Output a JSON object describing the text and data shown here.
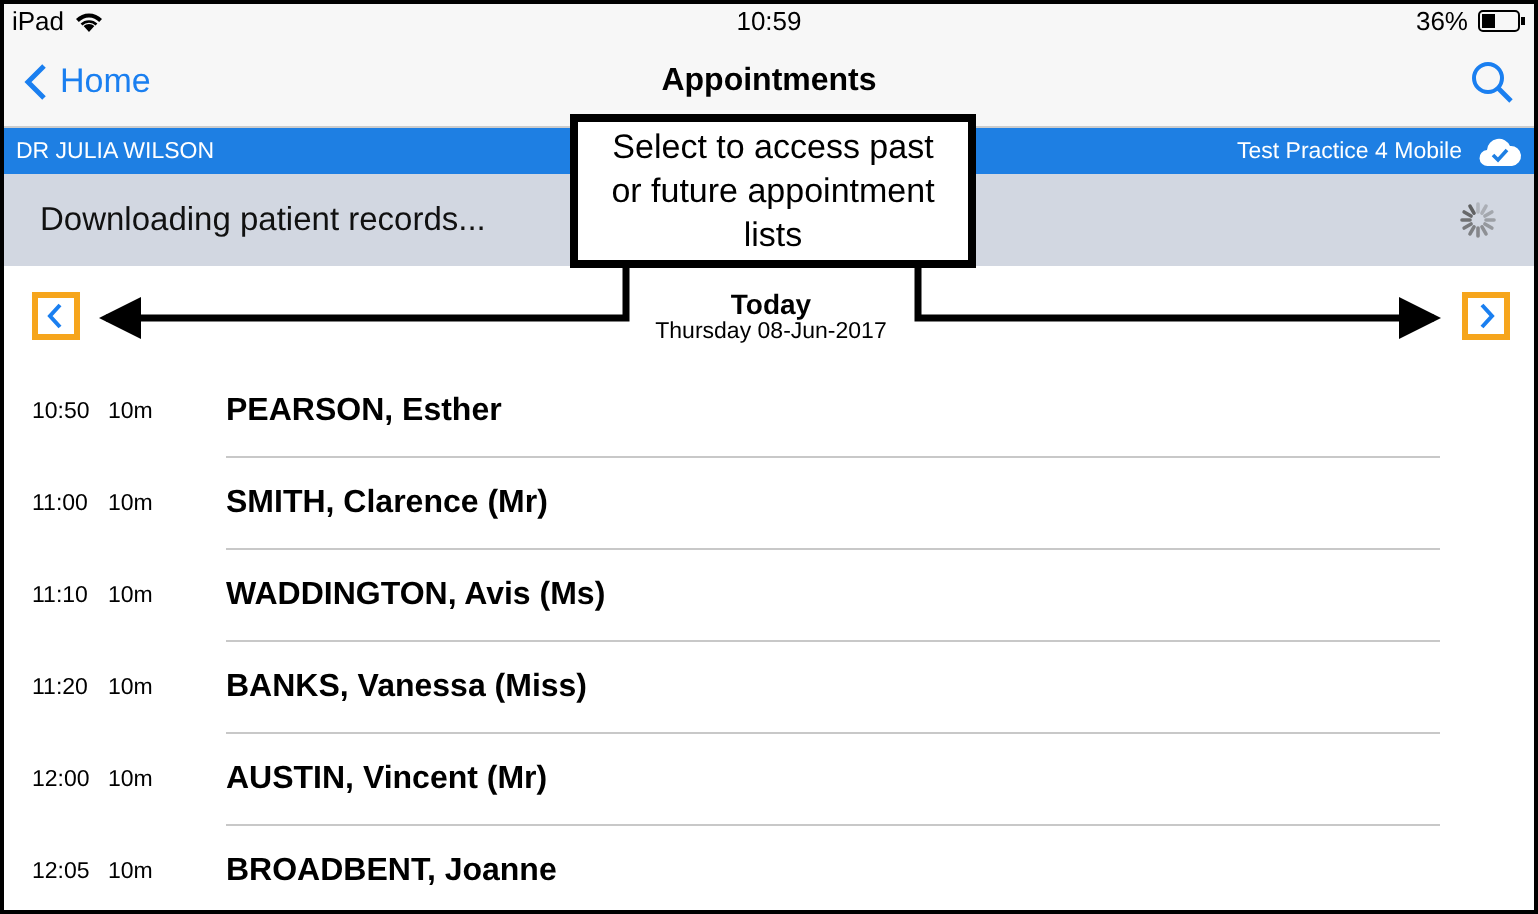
{
  "status_bar": {
    "device": "iPad",
    "time": "10:59",
    "battery": "36%"
  },
  "nav_bar": {
    "back": "Home",
    "title": "Appointments"
  },
  "info_bar": {
    "clinician": "DR JULIA WILSON",
    "practice": "Test Practice 4 Mobile"
  },
  "sync_banner": {
    "message": "Downloading patient records..."
  },
  "date_header": {
    "title": "Today",
    "date": "Thursday 08-Jun-2017"
  },
  "callout": {
    "text": "Select to access past or future appointment lists"
  },
  "appointments": [
    {
      "time": "10:50",
      "duration": "10m",
      "patient": "PEARSON, Esther"
    },
    {
      "time": "11:00",
      "duration": "10m",
      "patient": "SMITH, Clarence (Mr)"
    },
    {
      "time": "11:10",
      "duration": "10m",
      "patient": "WADDINGTON, Avis (Ms)"
    },
    {
      "time": "11:20",
      "duration": "10m",
      "patient": "BANKS, Vanessa (Miss)"
    },
    {
      "time": "12:00",
      "duration": "10m",
      "patient": "AUSTIN, Vincent (Mr)"
    },
    {
      "time": "12:05",
      "duration": "10m",
      "patient": "BROADBENT, Joanne"
    }
  ]
}
